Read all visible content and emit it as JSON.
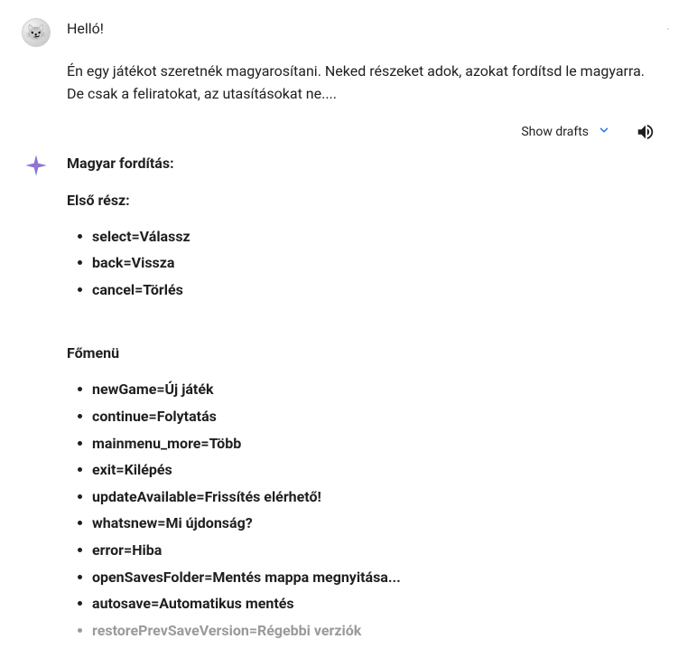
{
  "user": {
    "greeting": "Helló!",
    "body": "Én egy játékot szeretnék magyarosítani. Neked részeket adok, azokat fordítsd le magyarra. De csak a feliratokat, az utasításokat ne...."
  },
  "actions": {
    "show_drafts": "Show drafts"
  },
  "ai": {
    "title": "Magyar fordítás:",
    "section1_title": "Első rész:",
    "section1_items": [
      "select=Válassz",
      "back=Vissza",
      "cancel=Törlés"
    ],
    "section2_title": "Főmenü",
    "section2_items": [
      "newGame=Új játék",
      "continue=Folytatás",
      "mainmenu_more=Több",
      "exit=Kilépés",
      "updateAvailable=Frissítés elérhető!",
      "whatsnew=Mi újdonság?",
      "error=Hiba",
      "openSavesFolder=Mentés mappa megnyitása...",
      "autosave=Automatikus mentés",
      "restorePrevSaveVersion=Régebbi verziók"
    ]
  }
}
